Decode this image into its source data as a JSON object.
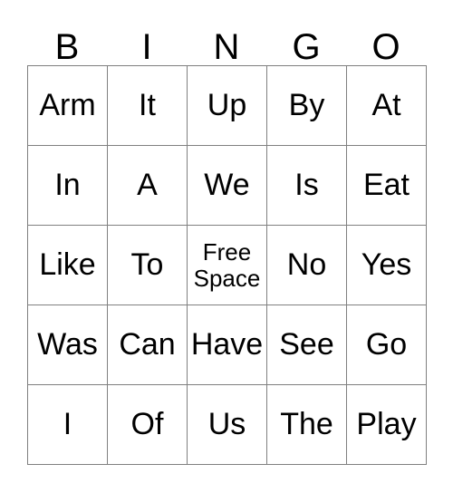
{
  "card": {
    "headers": [
      "B",
      "I",
      "N",
      "G",
      "O"
    ],
    "rows": [
      [
        "Arm",
        "It",
        "Up",
        "By",
        "At"
      ],
      [
        "In",
        "A",
        "We",
        "Is",
        "Eat"
      ],
      [
        "Like",
        "To",
        "Free Space",
        "No",
        "Yes"
      ],
      [
        "Was",
        "Can",
        "Have",
        "See",
        "Go"
      ],
      [
        "I",
        "Of",
        "Us",
        "The",
        "Play"
      ]
    ],
    "free_space_cell": {
      "row": 2,
      "col": 2,
      "label": "Free Space"
    },
    "colors": {
      "background": "#ffffff",
      "text": "#000000",
      "border": "#808080"
    }
  }
}
